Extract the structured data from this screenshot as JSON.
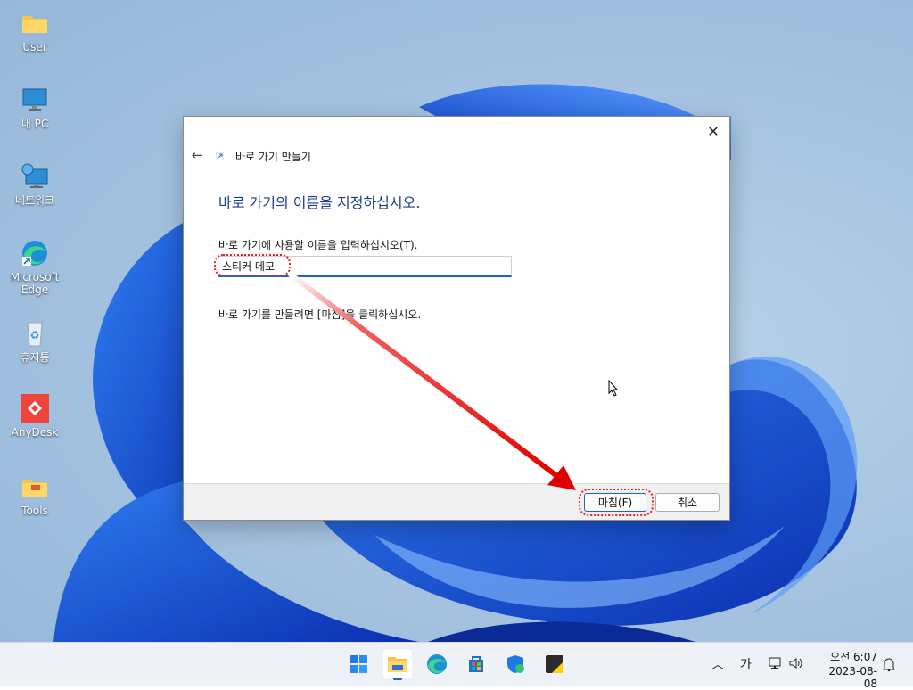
{
  "desktop": {
    "icons": [
      {
        "label": "User",
        "icon": "folder-icon"
      },
      {
        "label": "내 PC",
        "icon": "monitor-icon"
      },
      {
        "label": "네트워크",
        "icon": "network-icon"
      },
      {
        "label": "Microsoft\nEdge",
        "icon": "edge-icon"
      },
      {
        "label": "휴지통",
        "icon": "recycle-bin-icon"
      },
      {
        "label": "AnyDesk",
        "icon": "anydesk-icon"
      },
      {
        "label": "Tools",
        "icon": "folder-icon"
      }
    ]
  },
  "wizard": {
    "title": "바로 가기 만들기",
    "heading": "바로 가기의 이름을 지정하십시오.",
    "input_label": "바로 가기에 사용할 이름을 입력하십시오(T).",
    "input_value": "스티커 메모",
    "finish_note": "바로 가기를 만들려면 [마침]을 클릭하십시오.",
    "finish_label": "마침(F)",
    "cancel_label": "취소",
    "highlight_color": "#e6202a"
  },
  "taskbar": {
    "apps": [
      "start-icon",
      "file-explorer-icon",
      "edge-icon",
      "store-icon",
      "security-icon",
      "sticky-notes-icon"
    ],
    "ime": "가",
    "time": "오전 6:07",
    "date": "2023-08-08"
  }
}
